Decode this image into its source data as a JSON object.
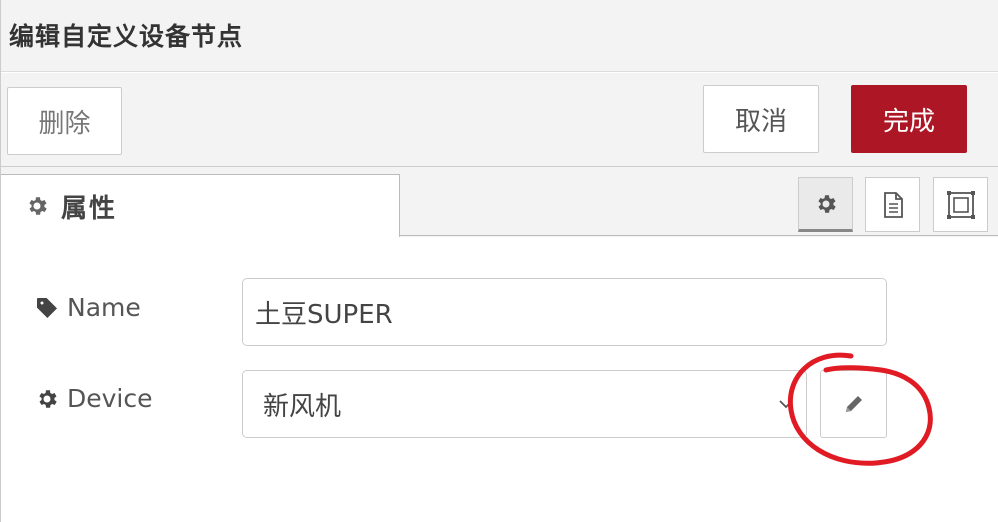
{
  "header": {
    "title": "编辑自定义设备节点"
  },
  "toolbar": {
    "delete_label": "删除",
    "cancel_label": "取消",
    "done_label": "完成",
    "done_color": "#ad1625"
  },
  "tabs": {
    "properties_label": "属性",
    "icons": [
      "gear-icon",
      "document-icon",
      "frame-icon"
    ]
  },
  "form": {
    "name": {
      "label": "Name",
      "value": "土豆SUPER",
      "icon": "tag-icon"
    },
    "device": {
      "label": "Device",
      "selected": "新风机",
      "icon": "gear-icon",
      "edit_icon": "pencil-icon"
    }
  },
  "annotation": {
    "color": "#e01b24",
    "shape": "hand-drawn-circle"
  }
}
